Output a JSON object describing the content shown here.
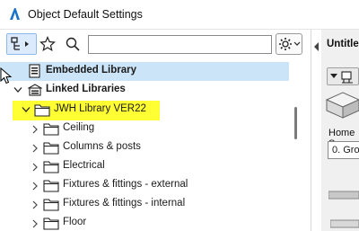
{
  "window": {
    "title": "Object Default Settings"
  },
  "toolbar": {
    "search": {
      "value": "",
      "placeholder": ""
    }
  },
  "tree": {
    "embedded": "Embedded Library",
    "linked": "Linked Libraries",
    "library": "JWH Library VER22",
    "folders": [
      "Ceiling",
      "Columns & posts",
      "Electrical",
      "Fixtures & fittings - external",
      "Fixtures & fittings - internal",
      "Floor"
    ]
  },
  "right_panel": {
    "title": "Untitled",
    "home_label": "Home S",
    "home_value": "0. Gro"
  },
  "colors": {
    "selection": "#cce4f7",
    "highlight": "#ffff33",
    "folder_fill": "#ffffff",
    "accent": "#1a73c8"
  }
}
